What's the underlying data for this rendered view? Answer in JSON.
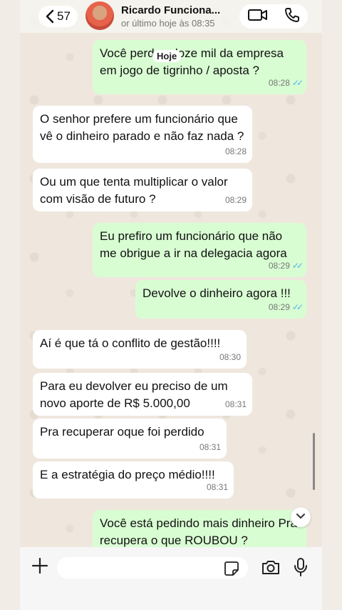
{
  "header": {
    "back_count": "57",
    "contact_name": "Ricardo Funciona...",
    "status": "or último hoje às 08:35"
  },
  "date_chip": "Hoje",
  "messages": [
    {
      "dir": "out",
      "text": "Você perdeu doze mil da empresa em jogo de tigrinho / aposta ?",
      "time": "08:28",
      "read": true
    },
    {
      "dir": "in",
      "text": "O senhor prefere um funcionário que vê o dinheiro parado e não faz nada ?",
      "time": "08:28"
    },
    {
      "dir": "in",
      "text": "Ou um que tenta multiplicar o valor com visão de futuro ?",
      "time": "08:29"
    },
    {
      "dir": "out",
      "text": "Eu prefiro um funcionário que não me obrigue a ir na delegacia agora",
      "time": "08:29",
      "read": true
    },
    {
      "dir": "out",
      "text": "Devolve o dinheiro agora !!!",
      "time": "08:29",
      "read": true
    },
    {
      "dir": "in",
      "text": "Aí é que tá o conflito de gestão!!!!",
      "time": "08:30"
    },
    {
      "dir": "in",
      "text": "Para eu devolver eu preciso de um novo aporte de R$ 5.000,00",
      "time": "08:31"
    },
    {
      "dir": "in",
      "text": "Pra recuperar oque foi perdido",
      "time": "08:31"
    },
    {
      "dir": "in",
      "text": "E a estratégia do preço médio!!!!",
      "time": "08:31"
    },
    {
      "dir": "out",
      "text": "Você está pedindo mais dinheiro Pra recupera o que ROUBOU ?",
      "time": "",
      "read": false
    }
  ],
  "composer": {
    "value": "",
    "placeholder": ""
  },
  "icons": {
    "back": "chevron-left-icon",
    "video": "video-camera-icon",
    "call": "phone-icon",
    "plus": "plus-icon",
    "sticker": "sticker-icon",
    "camera": "camera-icon",
    "mic": "microphone-icon",
    "scroll_down": "chevron-down-icon"
  },
  "colors": {
    "outgoing_bubble": "#d9fdd3",
    "incoming_bubble": "#ffffff",
    "read_ticks": "#4fb6ec",
    "chat_bg": "#efe7dd"
  }
}
